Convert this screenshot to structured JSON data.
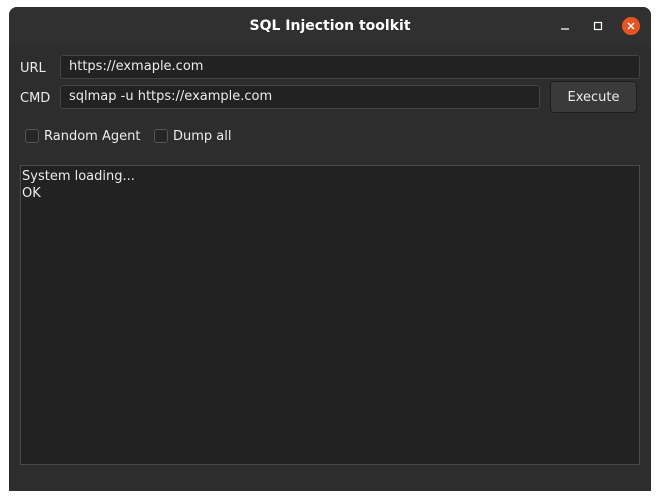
{
  "window": {
    "title": "SQL Injection toolkit"
  },
  "titlebar_buttons": {
    "minimize": "minimize-icon",
    "maximize": "maximize-icon",
    "close": "close-icon"
  },
  "form": {
    "url_label": "URL",
    "url_value": "https://exmaple.com",
    "cmd_label": "CMD",
    "cmd_value": "sqlmap -u https://example.com",
    "execute_label": "Execute"
  },
  "options": {
    "random_agent": {
      "label": "Random Agent",
      "checked": false
    },
    "dump_all": {
      "label": "Dump all",
      "checked": false
    }
  },
  "console": {
    "lines": [
      "System loading...",
      "OK"
    ]
  },
  "colors": {
    "window_bg": "#2d2d2d",
    "close_accent": "#e95420"
  }
}
